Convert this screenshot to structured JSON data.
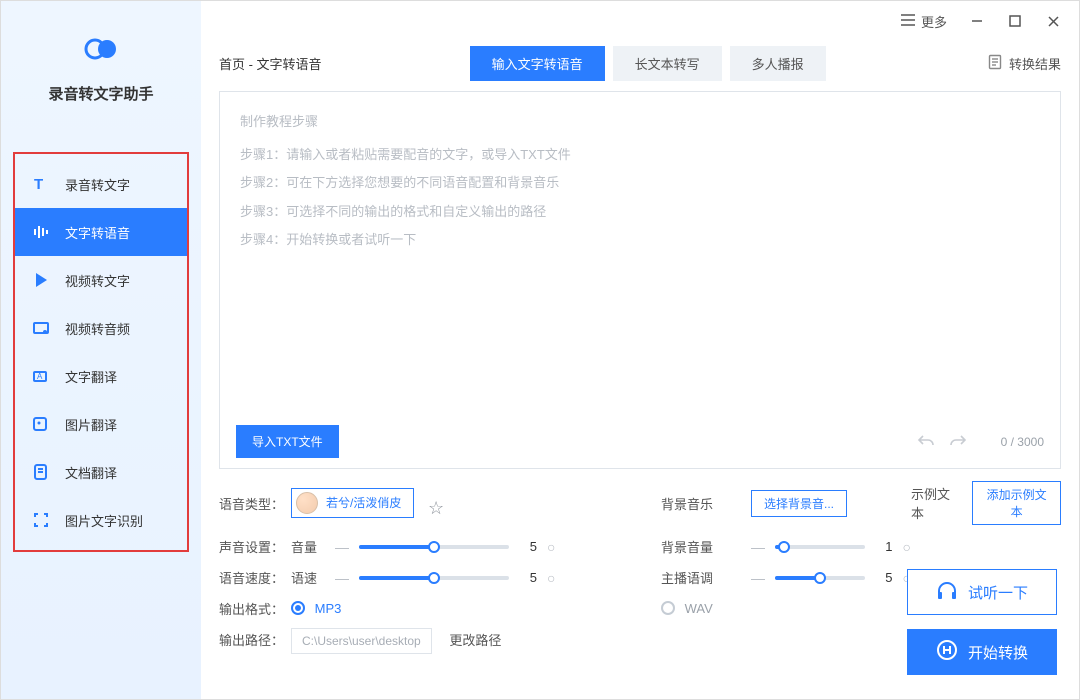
{
  "app": {
    "title": "录音转文字助手"
  },
  "sidebar": {
    "items": [
      {
        "label": "录音转文字"
      },
      {
        "label": "文字转语音"
      },
      {
        "label": "视频转文字"
      },
      {
        "label": "视频转音频"
      },
      {
        "label": "文字翻译"
      },
      {
        "label": "图片翻译"
      },
      {
        "label": "文档翻译"
      },
      {
        "label": "图片文字识别"
      }
    ],
    "active_index": 1
  },
  "titlebar": {
    "more_label": "更多"
  },
  "breadcrumb": "首页 - 文字转语音",
  "tabs": {
    "items": [
      {
        "label": "输入文字转语音"
      },
      {
        "label": "长文本转写"
      },
      {
        "label": "多人播报"
      }
    ],
    "active_index": 0
  },
  "result_link": "转换结果",
  "editor": {
    "placeholder_title": "制作教程步骤",
    "placeholder_lines": [
      "步骤1：请输入或者粘贴需要配音的文字，或导入TXT文件",
      "步骤2：可在下方选择您想要的不同语音配置和背景音乐",
      "步骤3：可选择不同的输出的格式和自定义输出的路径",
      "步骤4：开始转换或者试听一下"
    ],
    "import_button": "导入TXT文件",
    "counter": "0 / 3000"
  },
  "settings": {
    "voice_type_label": "语音类型：",
    "voice_chip": "若兮/活泼俏皮",
    "bgm_label": "背景音乐",
    "bgm_button": "选择背景音...",
    "example_label": "示例文本",
    "example_button": "添加示例文本",
    "sound_label": "声音设置：",
    "volume_label": "音量",
    "volume_value": "5",
    "bgm_volume_label": "背景音量",
    "bgm_volume_value": "1",
    "speed_label": "语音速度：",
    "rate_label": "语速",
    "rate_value": "5",
    "pitch_label": "主播语调",
    "pitch_value": "5",
    "format_label": "输出格式：",
    "format_mp3": "MP3",
    "format_wav": "WAV",
    "path_label": "输出路径：",
    "path_value": "C:\\Users\\user\\desktop",
    "change_path": "更改路径"
  },
  "actions": {
    "preview": "试听一下",
    "convert": "开始转换"
  },
  "colors": {
    "primary": "#2a7dff",
    "highlight_border": "#e23c3c"
  }
}
